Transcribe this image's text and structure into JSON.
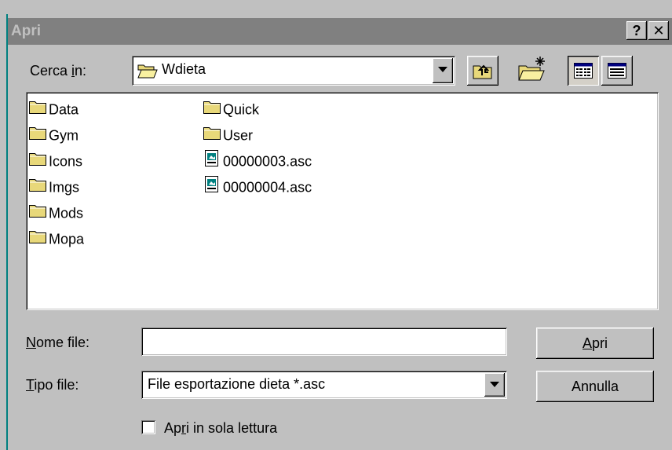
{
  "dialog": {
    "title": "Apri",
    "help_button": "?",
    "close_button": "✕"
  },
  "lookin": {
    "label_pre": "Cerca ",
    "label_ul": "i",
    "label_post": "n:",
    "value": "Wdieta"
  },
  "toolbar": {
    "up_icon": "up-one-level-icon",
    "new_folder_icon": "new-folder-icon",
    "list_icon": "list-view-icon",
    "details_icon": "details-view-icon"
  },
  "files": {
    "col1": [
      {
        "name": "Data",
        "type": "folder"
      },
      {
        "name": "Gym",
        "type": "folder"
      },
      {
        "name": "Icons",
        "type": "folder"
      },
      {
        "name": "Imgs",
        "type": "folder"
      },
      {
        "name": "Mods",
        "type": "folder"
      },
      {
        "name": "Mopa",
        "type": "folder"
      }
    ],
    "col2": [
      {
        "name": "Quick",
        "type": "folder"
      },
      {
        "name": "User",
        "type": "folder"
      },
      {
        "name": "00000003.asc",
        "type": "file"
      },
      {
        "name": "00000004.asc",
        "type": "file"
      }
    ]
  },
  "filename": {
    "label_ul": "N",
    "label_post": "ome file:",
    "value": ""
  },
  "filetype": {
    "label_ul": "T",
    "label_post": "ipo file:",
    "value": "File esportazione dieta *.asc"
  },
  "buttons": {
    "open_ul": "A",
    "open_post": "pri",
    "cancel": "Annulla"
  },
  "readonly": {
    "label_pre": "Ap",
    "label_ul": "r",
    "label_post": "i in sola lettura"
  },
  "colors": {
    "title_bg": "#808080",
    "face": "#c0c0c0",
    "folder": "#e8d87a",
    "file_accent": "#008080"
  }
}
